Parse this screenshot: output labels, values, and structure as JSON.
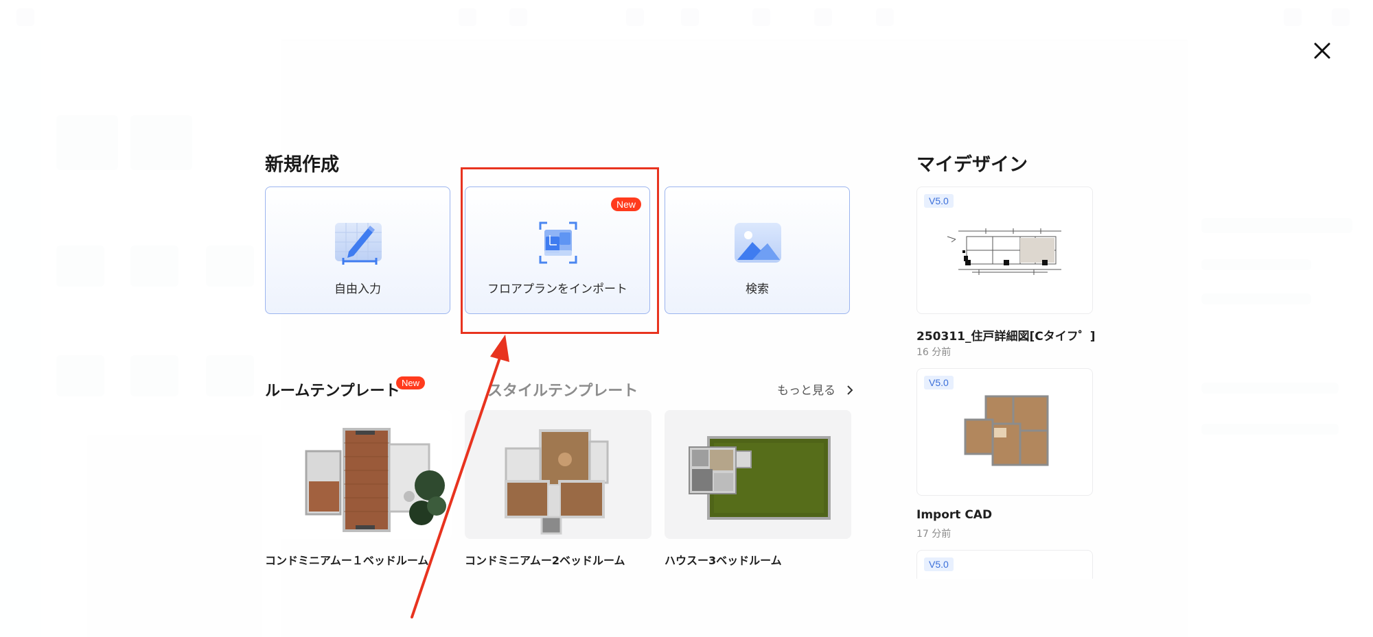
{
  "new_section": {
    "title": "新規作成",
    "cards": [
      {
        "label": "自由入力",
        "icon": "pencil-ruler-icon"
      },
      {
        "label": "フロアプランをインポート",
        "icon": "floorplan-scan-icon",
        "badge": "New"
      },
      {
        "label": "検索",
        "icon": "image-mountain-icon"
      }
    ]
  },
  "templates": {
    "tab_room": "ルームテンプレート",
    "tab_room_badge": "New",
    "tab_style": "スタイルテンプレート",
    "more": "もっと見る",
    "items": [
      {
        "name": "コンドミニアムー１ベッドルーム"
      },
      {
        "name": "コンドミニアムー2ベッドルーム"
      },
      {
        "name": "ハウスー3ベッドルーム"
      }
    ]
  },
  "my_designs": {
    "title": "マイデザイン",
    "items": [
      {
        "version": "V5.0",
        "name": "250311_住戸詳細図[Cタイフ゜]",
        "time": "16 分前"
      },
      {
        "version": "V5.0",
        "name": "Import CAD",
        "time": "17 分前"
      },
      {
        "version": "V5.0"
      }
    ]
  },
  "colors": {
    "accent": "#3b6fd9",
    "highlight": "#e8331f",
    "badge": "#ff3b1d"
  }
}
